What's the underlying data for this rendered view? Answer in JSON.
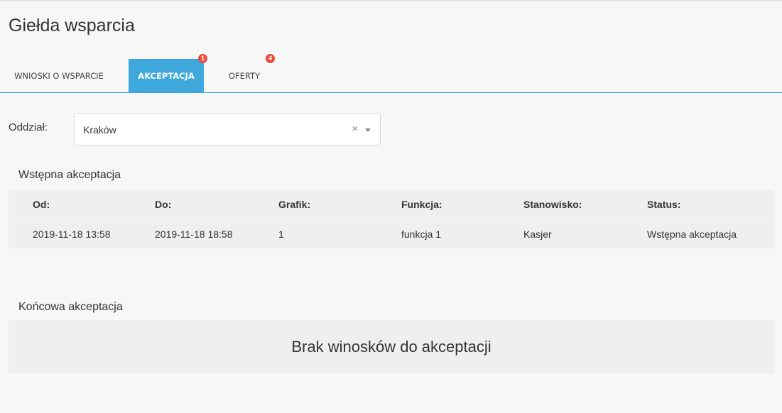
{
  "page": {
    "title": "Giełda wsparcia"
  },
  "tabs": [
    {
      "label": "WNIOSKI O WSPARCIE",
      "badge": ""
    },
    {
      "label": "AKCEPTACJA",
      "badge": "1",
      "active": true
    },
    {
      "label": "OFERTY",
      "badge": "4"
    }
  ],
  "filter": {
    "label": "Oddział:",
    "value": "Kraków",
    "clear_glyph": "×"
  },
  "preliminary": {
    "title": "Wstępna akceptacja",
    "columns": [
      "Od:",
      "Do:",
      "Grafik:",
      "Funkcja:",
      "Stanowisko:",
      "Status:"
    ],
    "rows": [
      [
        "2019-11-18 13:58",
        "2019-11-18 18:58",
        "1",
        "funkcja 1",
        "Kasjer",
        "Wstępna akceptacja"
      ]
    ]
  },
  "final": {
    "title": "Końcowa akceptacja",
    "empty_message": "Brak winosków do akceptacji"
  },
  "colors": {
    "accent": "#3ea8dd",
    "badge": "#e74c3c",
    "row_bg": "#efefef",
    "page_bg": "#f7f7f7"
  }
}
